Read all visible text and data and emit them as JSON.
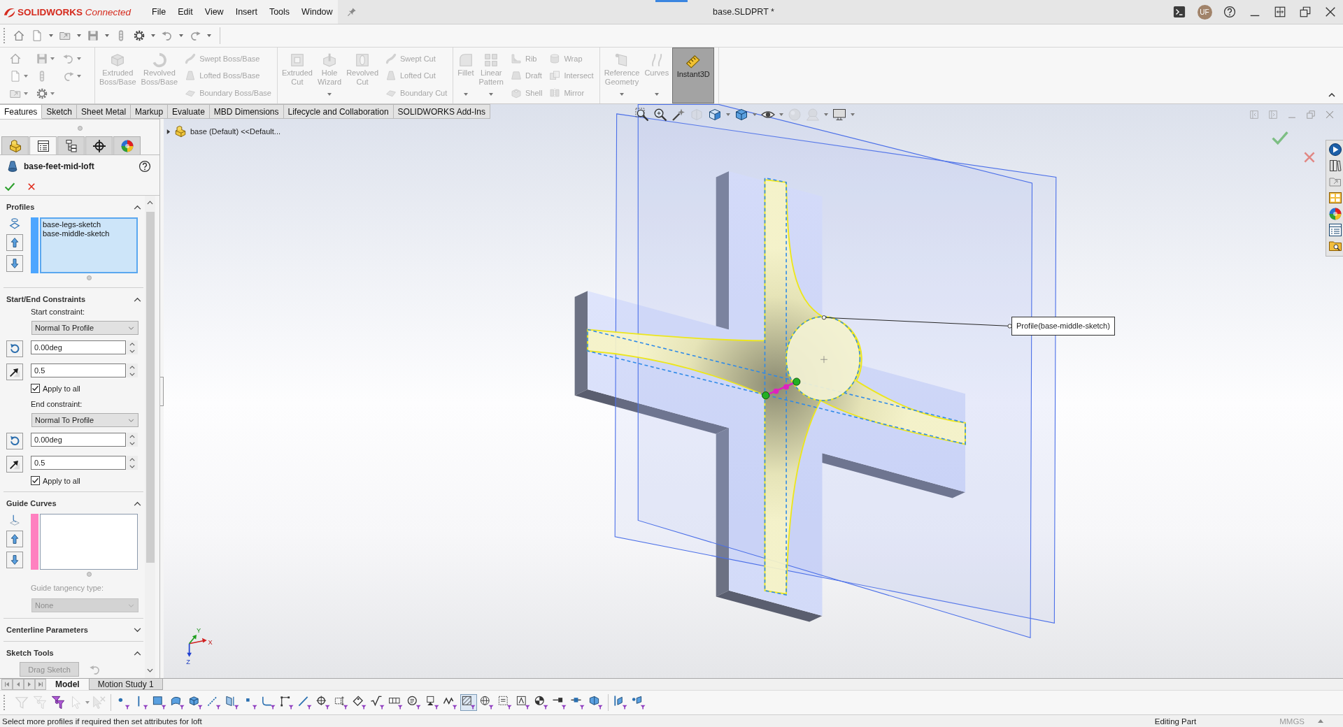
{
  "title_bar": {
    "logo": "**SOLIDWORKS** *Connected*",
    "menus": [
      "File",
      "Edit",
      "View",
      "Insert",
      "Tools",
      "Window"
    ],
    "document_title": "base.SLDPRT *",
    "avatar_initials": "UF"
  },
  "ribbon": {
    "groups": [
      {
        "items": [
          {
            "kind": "large",
            "label": "Extruded Boss/Base",
            "disabled": true
          },
          {
            "kind": "large",
            "label": "Revolved Boss/Base",
            "disabled": true
          },
          {
            "kind": "column",
            "items": [
              {
                "label": "Swept Boss/Base",
                "disabled": true
              },
              {
                "label": "Lofted Boss/Base",
                "disabled": true
              },
              {
                "label": "Boundary Boss/Base",
                "disabled": true
              }
            ]
          }
        ]
      },
      {
        "items": [
          {
            "kind": "large",
            "label": "Extruded Cut",
            "disabled": true
          },
          {
            "kind": "large",
            "label": "Hole Wizard",
            "disabled": true,
            "dropdown": true
          },
          {
            "kind": "large",
            "label": "Revolved Cut",
            "disabled": true
          },
          {
            "kind": "column",
            "items": [
              {
                "label": "Swept Cut",
                "disabled": true
              },
              {
                "label": "Lofted Cut",
                "disabled": true
              },
              {
                "label": "Boundary Cut",
                "disabled": true
              }
            ]
          }
        ]
      },
      {
        "items": [
          {
            "kind": "large",
            "label": "Fillet",
            "disabled": true,
            "dropdown": true
          },
          {
            "kind": "large",
            "label": "Linear Pattern",
            "disabled": true,
            "dropdown": true
          },
          {
            "kind": "column",
            "items": [
              {
                "label": "Rib",
                "disabled": true
              },
              {
                "label": "Draft",
                "disabled": true
              },
              {
                "label": "Shell",
                "disabled": true
              }
            ]
          },
          {
            "kind": "column",
            "items": [
              {
                "label": "Wrap",
                "disabled": true
              },
              {
                "label": "Intersect",
                "disabled": true
              },
              {
                "label": "Mirror",
                "disabled": true
              }
            ]
          }
        ]
      },
      {
        "items": [
          {
            "kind": "large",
            "label": "Reference Geometry",
            "disabled": true,
            "dropdown": true
          },
          {
            "kind": "large",
            "label": "Curves",
            "disabled": true,
            "dropdown": true
          },
          {
            "kind": "toggle",
            "label": "Instant3D",
            "on": true
          }
        ]
      }
    ],
    "tabs": [
      {
        "label": "Features",
        "selected": true
      },
      {
        "label": "Sketch",
        "selected": false
      },
      {
        "label": "Sheet Metal",
        "selected": false
      },
      {
        "label": "Markup",
        "selected": false
      },
      {
        "label": "Evaluate",
        "selected": false
      },
      {
        "label": "MBD Dimensions",
        "selected": false
      },
      {
        "label": "Lifecycle and Collaboration",
        "selected": false
      },
      {
        "label": "SOLIDWORKS Add-Ins",
        "selected": false
      }
    ]
  },
  "property_manager": {
    "tabs": [
      {
        "kind": "tree",
        "selected": false
      },
      {
        "kind": "properties",
        "selected": true
      },
      {
        "kind": "configurations",
        "selected": false
      },
      {
        "kind": "dimxpert",
        "selected": false
      },
      {
        "kind": "display",
        "selected": false
      }
    ],
    "title": "base-feet-mid-loft",
    "sections": [
      {
        "kind": "profiles",
        "title": "Profiles",
        "expanded": true,
        "color": "#4da6ff",
        "active": true,
        "entries": [
          "base-legs-sketch",
          "base-middle-sketch"
        ]
      },
      {
        "kind": "constraints",
        "title": "Start/End Constraints",
        "expanded": true,
        "groups": [
          {
            "label": "Start constraint:",
            "choice": "Normal To Profile",
            "angle": "0.00deg",
            "length": "0.5",
            "apply_label": "Apply to all",
            "apply_to_all": true
          },
          {
            "label": "End constraint:",
            "choice": "Normal To Profile",
            "angle": "0.00deg",
            "length": "0.5",
            "apply_label": "Apply to all",
            "apply_to_all": true
          }
        ]
      },
      {
        "kind": "guides",
        "title": "Guide Curves",
        "expanded": true,
        "color": "#ff80c0",
        "active": false,
        "tangency_label": "Guide tangency type:",
        "tangency": "None",
        "tangency_disabled": true
      },
      {
        "title": "Centerline Parameters",
        "expanded": false
      },
      {
        "kind": "tools",
        "title": "Sketch Tools",
        "expanded": true,
        "button": "Drag Sketch",
        "button_disabled": true
      }
    ]
  },
  "graphics_area": {
    "feature_tree": {
      "label": "base (Default) <<Default...",
      "expanded": false
    },
    "heads_up_toolbar": [
      {
        "disabled": false
      },
      {
        "disabled": false
      },
      {
        "disabled": false
      },
      {
        "disabled": true
      },
      {
        "disabled": false
      },
      {
        "disabled": false
      },
      {
        "disabled": false
      },
      {
        "disabled": true
      },
      {
        "disabled": true
      },
      {
        "disabled": false
      }
    ],
    "callout": "Profile(base-middle-sketch)",
    "triad": {
      "x": "X",
      "y": "Y",
      "z": "Z"
    }
  },
  "bottom_tabs": [
    {
      "label": "Model",
      "selected": true
    },
    {
      "label": "Motion Study 1",
      "selected": false
    }
  ],
  "selection_filter": {
    "tools": [
      {
        "disabled": true
      },
      {
        "disabled": true
      },
      {
        "disabled": false
      },
      {
        "disabled": true
      },
      {
        "disabled": true
      }
    ],
    "filters": [
      {
        "on": false
      },
      {
        "on": false
      },
      {
        "on": false
      },
      {
        "on": false
      },
      {
        "on": false
      },
      {
        "on": false
      },
      {
        "on": false
      },
      {
        "on": false
      },
      {
        "on": false
      },
      {
        "on": false
      },
      {
        "on": false
      },
      {
        "on": false
      },
      {
        "on": false
      },
      {
        "on": false
      },
      {
        "on": false
      },
      {
        "on": false
      },
      {
        "on": false
      },
      {
        "on": false
      },
      {
        "on": false
      },
      {
        "on": true
      },
      {
        "on": false
      },
      {
        "on": false
      },
      {
        "on": false
      },
      {
        "on": false
      },
      {
        "on": false
      },
      {
        "on": false
      },
      {
        "on": false
      },
      {
        "on": false
      },
      {
        "on": false
      }
    ]
  },
  "status_bar": {
    "message": "Select more profiles if required then set attributes for loft",
    "mode": "Editing Part",
    "units": "MMGS"
  }
}
